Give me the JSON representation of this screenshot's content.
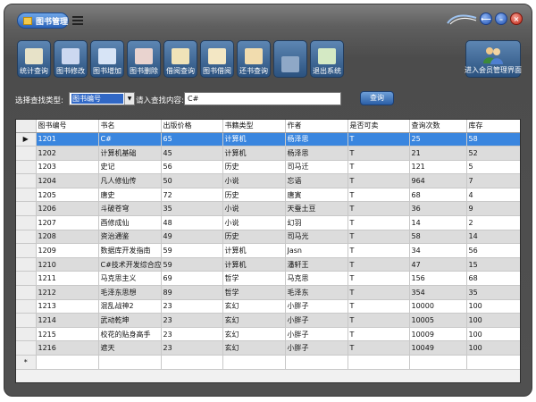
{
  "window": {
    "title": "图书管理",
    "controls": [
      "⟵",
      "–",
      "×"
    ]
  },
  "toolbar": [
    {
      "label": "统计查询",
      "icon": "book-stats-icon",
      "color": "#e7e2c8"
    },
    {
      "label": "图书修改",
      "icon": "pencil-book-icon",
      "color": "#ccd8f0"
    },
    {
      "label": "图书增加",
      "icon": "book-add-icon",
      "color": "#d7e4f6"
    },
    {
      "label": "图书删除",
      "icon": "book-delete-icon",
      "color": "#e9d3cf"
    },
    {
      "label": "借阅查询",
      "icon": "books-icon",
      "color": "#f0e3b8"
    },
    {
      "label": "图书借阅",
      "icon": "open-book-icon",
      "color": "#f3e7c4"
    },
    {
      "label": "还书查询",
      "icon": "return-book-icon",
      "color": "#f1dcae"
    },
    {
      "label": "",
      "icon": "chain-link-icon",
      "color": "#8fa8c7"
    },
    {
      "label": "退出系统",
      "icon": "exit-icon",
      "color": "#d4e9c4"
    }
  ],
  "member_button": {
    "label": "进入会员管理界面",
    "icon": "users-icon"
  },
  "search": {
    "type_label": "选择查找类型:",
    "type_value": "图书编号",
    "content_label": "请入查找内容:",
    "content_value": "C#",
    "query_label": "查询"
  },
  "table": {
    "columns": [
      "图书编号",
      "书名",
      "出版价格",
      "书籍类型",
      "作者",
      "是否可卖",
      "查询次数",
      "库存"
    ],
    "selected_row": 0,
    "rows": [
      [
        "1201",
        "C#",
        "65",
        "计算机",
        "杨泽思",
        "T",
        "25",
        "58"
      ],
      [
        "1202",
        "计算机基础",
        "45",
        "计算机",
        "杨泽思",
        "T",
        "21",
        "52"
      ],
      [
        "1203",
        "史记",
        "56",
        "历史",
        "司马迁",
        "T",
        "121",
        "5"
      ],
      [
        "1204",
        "凡人修仙传",
        "50",
        "小说",
        "忘语",
        "T",
        "964",
        "7"
      ],
      [
        "1205",
        "唐史",
        "72",
        "历史",
        "唐寅",
        "T",
        "68",
        "4"
      ],
      [
        "1206",
        "斗破苍穹",
        "35",
        "小说",
        "天蚕土豆",
        "T",
        "36",
        "9"
      ],
      [
        "1207",
        "酉修成仙",
        "48",
        "小说",
        "幻羽",
        "T",
        "14",
        "2"
      ],
      [
        "1208",
        "资治通鉴",
        "49",
        "历史",
        "司马光",
        "T",
        "58",
        "14"
      ],
      [
        "1209",
        "数据库开发指南",
        "59",
        "计算机",
        "Jasn",
        "T",
        "34",
        "56"
      ],
      [
        "1210",
        "C#技术开发综合应用",
        "59",
        "计算机",
        "潘轩王",
        "T",
        "47",
        "15"
      ],
      [
        "1211",
        "马克思主义",
        "69",
        "哲学",
        "马克思",
        "T",
        "156",
        "68"
      ],
      [
        "1212",
        "毛泽东思想",
        "89",
        "哲学",
        "毛泽东",
        "T",
        "354",
        "35"
      ],
      [
        "1213",
        "混乱战神2",
        "23",
        "玄幻",
        "小胖子",
        "T",
        "10000",
        "100"
      ],
      [
        "1214",
        "武动乾坤",
        "23",
        "玄幻",
        "小胖子",
        "T",
        "10005",
        "100"
      ],
      [
        "1215",
        "校花的贴身高手",
        "23",
        "玄幻",
        "小胖子",
        "T",
        "10009",
        "100"
      ],
      [
        "1216",
        "遮天",
        "23",
        "玄幻",
        "小胖子",
        "T",
        "10049",
        "100"
      ]
    ],
    "current_marker": "▶",
    "new_row_marker": "*"
  },
  "colors": {
    "selection": "#3a86df",
    "alt_row": "#dcdcdc",
    "frame": "#4c4c4c",
    "toolbar_button": "#2b527f"
  }
}
